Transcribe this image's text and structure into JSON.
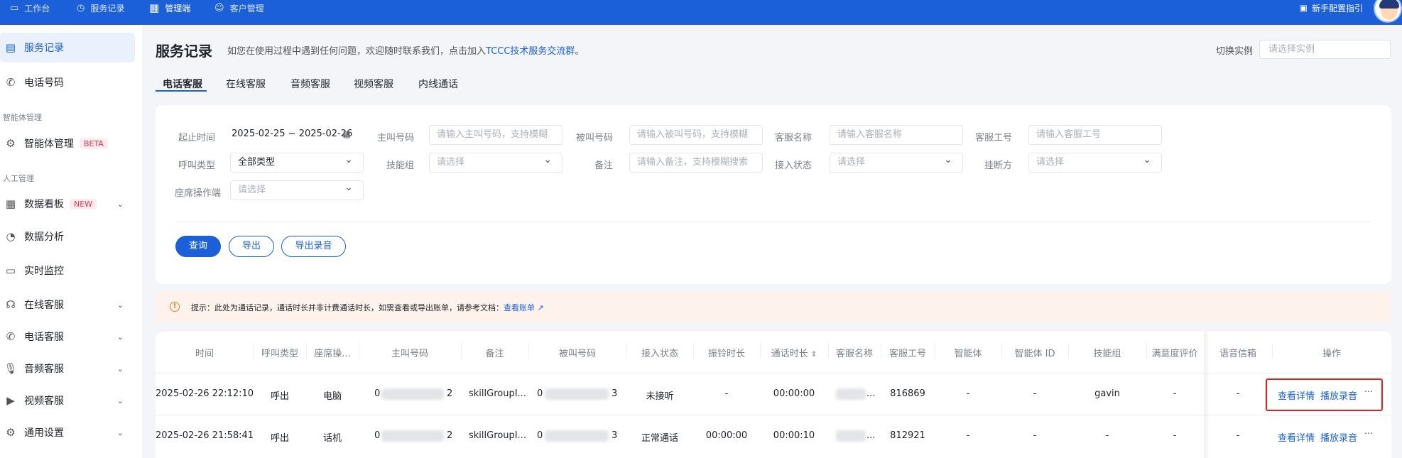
{
  "topbar": {
    "nav": [
      {
        "label": "工作台",
        "icon": "monitor-icon"
      },
      {
        "label": "服务记录",
        "icon": "clock-icon"
      },
      {
        "label": "管理端",
        "icon": "grid-icon"
      },
      {
        "label": "客户管理",
        "icon": "user-icon"
      }
    ],
    "guide_label": "新手配置指引"
  },
  "sidebar": {
    "items": [
      {
        "label": "服务记录",
        "icon": "document-icon",
        "active": true
      },
      {
        "label": "电话号码",
        "icon": "phone-icon"
      },
      {
        "label": "智能体管理",
        "icon": "gear-icon",
        "badge": "BETA"
      },
      {
        "label": "数据看板",
        "icon": "dashboard-icon",
        "badge": "NEW"
      },
      {
        "label": "数据分析",
        "icon": "pie-icon"
      },
      {
        "label": "实时监控",
        "icon": "monitor-icon"
      },
      {
        "label": "在线客服",
        "icon": "headset-icon"
      },
      {
        "label": "电话客服",
        "icon": "phone-icon"
      },
      {
        "label": "音频客服",
        "icon": "mic-icon"
      },
      {
        "label": "视频客服",
        "icon": "video-icon"
      },
      {
        "label": "通用设置",
        "icon": "gear-icon"
      }
    ],
    "groups": [
      "智能体管理",
      "人工管理"
    ]
  },
  "header": {
    "title": "服务记录",
    "hint_prefix": "如您在使用过程中遇到任何问题，欢迎随时联系我们，点击加入",
    "hint_link": "TCCC技术服务交流群",
    "hint_suffix": "。",
    "switch_label": "切换实例",
    "switch_placeholder": "请选择实例"
  },
  "tabs": [
    "电话客服",
    "在线客服",
    "音频客服",
    "视频客服",
    "内线通话"
  ],
  "filters": {
    "time_label": "起止时间",
    "time_value": "2025-02-25 ~ 2025-02-26",
    "caller_label": "主叫号码",
    "caller_placeholder": "请输入主叫号码，支持模糊",
    "callee_label": "被叫号码",
    "callee_placeholder": "请输入被叫号码，支持模糊",
    "agent_name_label": "客服名称",
    "agent_name_placeholder": "请输入客服名称",
    "agent_id_label": "客服工号",
    "agent_id_placeholder": "请输入客服工号",
    "call_type_label": "呼叫类型",
    "call_type_value": "全部类型",
    "skill_label": "技能组",
    "skill_placeholder": "请选择",
    "remark_label": "备注",
    "remark_placeholder": "请输入备注，支持模糊搜索",
    "access_label": "接入状态",
    "access_placeholder": "请选择",
    "hangup_label": "挂断方",
    "hangup_placeholder": "请选择",
    "seat_label": "座席操作端",
    "seat_placeholder": "请选择"
  },
  "buttons": {
    "query": "查询",
    "export": "导出",
    "export_audio": "导出录音"
  },
  "notice": {
    "text": "提示：此处为通话记录，通话时长并非计费通话时长，如需查看或导出账单，请参考文档：",
    "link": "查看账单"
  },
  "table": {
    "columns": [
      "时间",
      "呼叫类型",
      "座席操...",
      "主叫号码",
      "备注",
      "被叫号码",
      "接入状态",
      "振铃时长",
      "通话时长",
      "客服名称",
      "客服工号",
      "智能体",
      "智能体 ID",
      "技能组",
      "满意度评价",
      "语音信箱",
      "操作"
    ],
    "rows": [
      {
        "time": "2025-02-26 22:12:10",
        "call_type": "呼出",
        "seat": "电脑",
        "caller_prefix": "0",
        "caller_suffix": "2",
        "remark": "skillGroupI...",
        "callee_prefix": "0",
        "callee_suffix": "3",
        "access": "未接听",
        "ring": "-",
        "duration": "00:00:00",
        "agent_name": "...",
        "agent_id": "816869",
        "bot": "-",
        "bot_id": "-",
        "skill": "gavin",
        "rating": "-",
        "voicemail": "-"
      },
      {
        "time": "2025-02-26 21:58:41",
        "call_type": "呼出",
        "seat": "话机",
        "caller_prefix": "0",
        "caller_suffix": "2",
        "remark": "skillGroupI...",
        "callee_prefix": "0",
        "callee_suffix": "3",
        "access": "正常通话",
        "ring": "00:00:00",
        "duration": "00:00:10",
        "agent_name": "...",
        "agent_id": "812921",
        "bot": "-",
        "bot_id": "-",
        "skill": "-",
        "rating": "-",
        "voicemail": "-"
      }
    ],
    "actions": {
      "detail": "查看详情",
      "play": "播放录音",
      "more": "···"
    }
  }
}
